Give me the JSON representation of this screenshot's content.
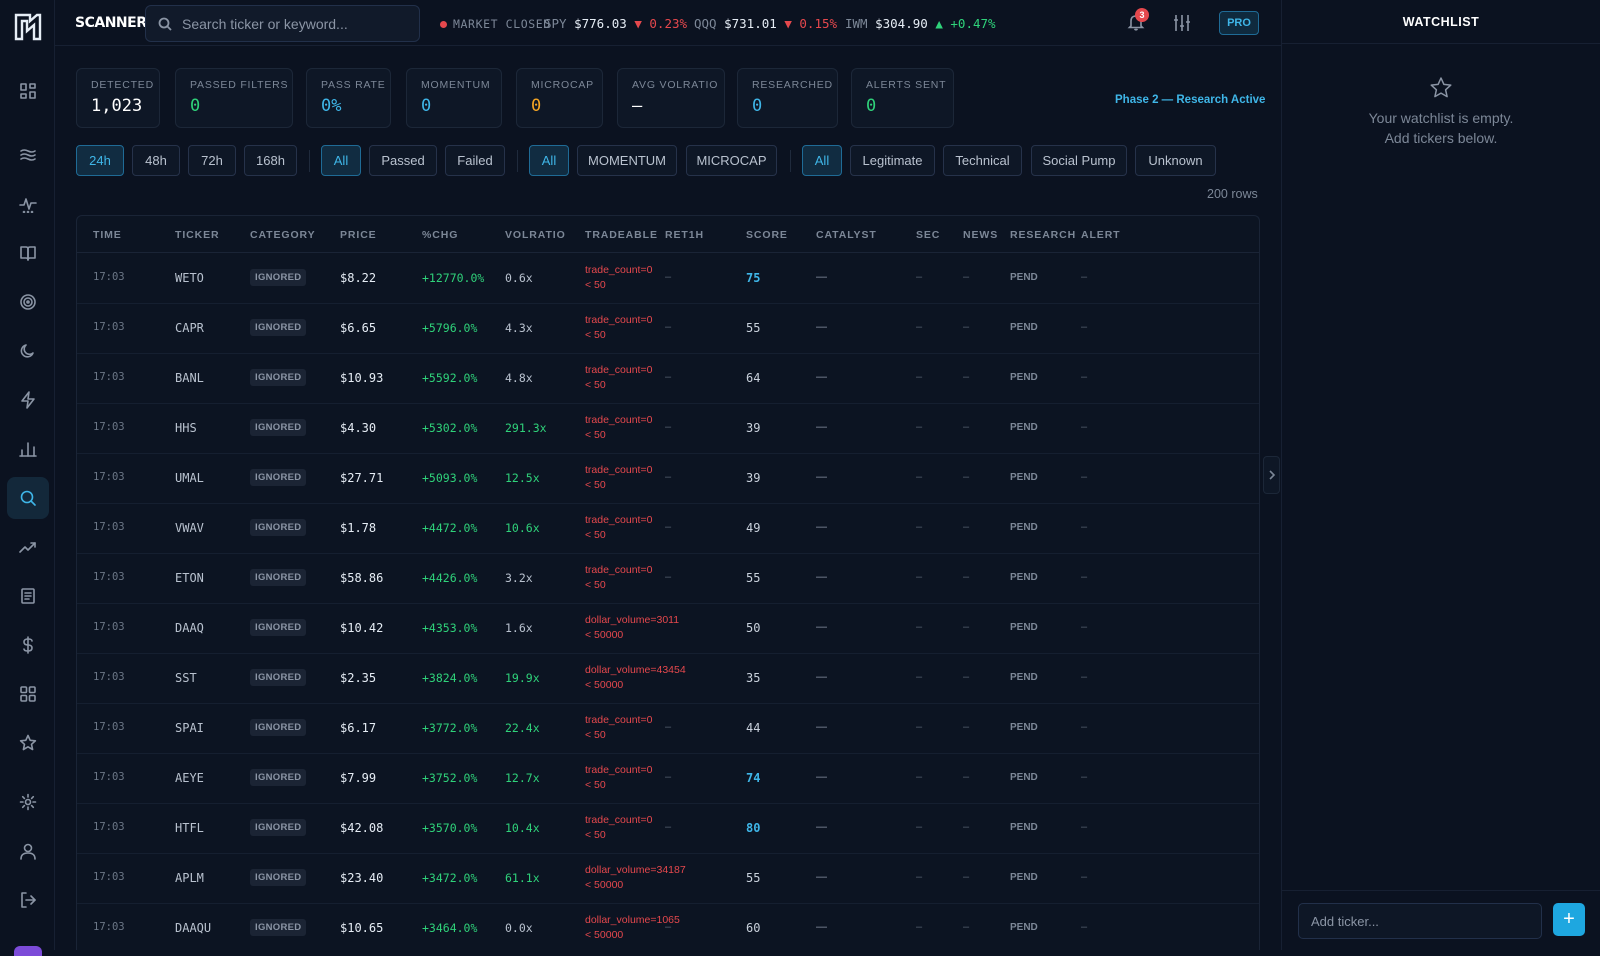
{
  "app": {
    "brand": "SCANNER",
    "search_placeholder": "Search ticker or keyword...",
    "market_status": "MARKET CLOSED",
    "indices": [
      {
        "sym": "SPY",
        "price": "$776.03",
        "arrow": "▼",
        "change": "0.23%",
        "dir": "down"
      },
      {
        "sym": "QQQ",
        "price": "$731.01",
        "arrow": "▼",
        "change": "0.15%",
        "dir": "down"
      },
      {
        "sym": "IWM",
        "price": "$304.90",
        "arrow": "▲",
        "change": "+0.47%",
        "dir": "up"
      }
    ],
    "notification_count": "3",
    "plan_badge": "PRO"
  },
  "stats": [
    {
      "label": "DETECTED",
      "value": "1,023",
      "color": "#ffffff"
    },
    {
      "label": "PASSED FILTERS",
      "value": "0",
      "color": "#2fd27a"
    },
    {
      "label": "PASS RATE",
      "value": "0%",
      "color": "#3fb6e8"
    },
    {
      "label": "MOMENTUM",
      "value": "0",
      "color": "#3fb6e8"
    },
    {
      "label": "MICROCAP",
      "value": "0",
      "color": "#f5a524"
    },
    {
      "label": "AVG VOLRATIO",
      "value": "—",
      "color": "#ffffff"
    },
    {
      "label": "RESEARCHED",
      "value": "0",
      "color": "#3fb6e8"
    },
    {
      "label": "ALERTS SENT",
      "value": "0",
      "color": "#2fd27a"
    }
  ],
  "phase_label": "Phase 2 — Research Active",
  "filters": {
    "timeframe": [
      "24h",
      "48h",
      "72h",
      "168h"
    ],
    "status": [
      "All",
      "Passed",
      "Failed"
    ],
    "category": [
      "All",
      "MOMENTUM",
      "MICROCAP"
    ],
    "research": [
      "All",
      "Legitimate",
      "Technical",
      "Social Pump",
      "Unknown"
    ]
  },
  "row_count": "200 rows",
  "table": {
    "columns": [
      "TIME",
      "TICKER",
      "CATEGORY",
      "PRICE",
      "%CHG",
      "VOLRATIO",
      "TRADEABLE",
      "RET1H",
      "SCORE",
      "CATALYST",
      "SEC",
      "NEWS",
      "RESEARCH",
      "ALERT"
    ],
    "rows": [
      {
        "time": "17:03",
        "ticker": "WETO",
        "category": "IGNORED",
        "price": "$8.22",
        "chg": "+12770.0%",
        "vol": "0.6x",
        "vol_hi": false,
        "trade1": "trade_count=0",
        "trade2": "< 50",
        "ret": "–",
        "score": "75",
        "score_hi": true,
        "catalyst": "—",
        "sec": "–",
        "news": "–",
        "research": "PEND",
        "alert": "–"
      },
      {
        "time": "17:03",
        "ticker": "CAPR",
        "category": "IGNORED",
        "price": "$6.65",
        "chg": "+5796.0%",
        "vol": "4.3x",
        "vol_hi": false,
        "trade1": "trade_count=0",
        "trade2": "< 50",
        "ret": "–",
        "score": "55",
        "score_hi": false,
        "catalyst": "—",
        "sec": "–",
        "news": "–",
        "research": "PEND",
        "alert": "–"
      },
      {
        "time": "17:03",
        "ticker": "BANL",
        "category": "IGNORED",
        "price": "$10.93",
        "chg": "+5592.0%",
        "vol": "4.8x",
        "vol_hi": false,
        "trade1": "trade_count=0",
        "trade2": "< 50",
        "ret": "–",
        "score": "64",
        "score_hi": false,
        "catalyst": "—",
        "sec": "–",
        "news": "–",
        "research": "PEND",
        "alert": "–"
      },
      {
        "time": "17:03",
        "ticker": "HHS",
        "category": "IGNORED",
        "price": "$4.30",
        "chg": "+5302.0%",
        "vol": "291.3x",
        "vol_hi": true,
        "trade1": "trade_count=0",
        "trade2": "< 50",
        "ret": "–",
        "score": "39",
        "score_hi": false,
        "catalyst": "—",
        "sec": "–",
        "news": "–",
        "research": "PEND",
        "alert": "–"
      },
      {
        "time": "17:03",
        "ticker": "UMAL",
        "category": "IGNORED",
        "price": "$27.71",
        "chg": "+5093.0%",
        "vol": "12.5x",
        "vol_hi": true,
        "trade1": "trade_count=0",
        "trade2": "< 50",
        "ret": "–",
        "score": "39",
        "score_hi": false,
        "catalyst": "—",
        "sec": "–",
        "news": "–",
        "research": "PEND",
        "alert": "–"
      },
      {
        "time": "17:03",
        "ticker": "VWAV",
        "category": "IGNORED",
        "price": "$1.78",
        "chg": "+4472.0%",
        "vol": "10.6x",
        "vol_hi": true,
        "trade1": "trade_count=0",
        "trade2": "< 50",
        "ret": "–",
        "score": "49",
        "score_hi": false,
        "catalyst": "—",
        "sec": "–",
        "news": "–",
        "research": "PEND",
        "alert": "–"
      },
      {
        "time": "17:03",
        "ticker": "ETON",
        "category": "IGNORED",
        "price": "$58.86",
        "chg": "+4426.0%",
        "vol": "3.2x",
        "vol_hi": false,
        "trade1": "trade_count=0",
        "trade2": "< 50",
        "ret": "–",
        "score": "55",
        "score_hi": false,
        "catalyst": "—",
        "sec": "–",
        "news": "–",
        "research": "PEND",
        "alert": "–"
      },
      {
        "time": "17:03",
        "ticker": "DAAQ",
        "category": "IGNORED",
        "price": "$10.42",
        "chg": "+4353.0%",
        "vol": "1.6x",
        "vol_hi": false,
        "trade1": "dollar_volume=3011",
        "trade2": "< 50000",
        "ret": "",
        "score": "50",
        "score_hi": false,
        "catalyst": "—",
        "sec": "–",
        "news": "–",
        "research": "PEND",
        "alert": "–"
      },
      {
        "time": "17:03",
        "ticker": "SST",
        "category": "IGNORED",
        "price": "$2.35",
        "chg": "+3824.0%",
        "vol": "19.9x",
        "vol_hi": true,
        "trade1": "dollar_volume=43454",
        "trade2": "< 50000",
        "ret": "",
        "score": "35",
        "score_hi": false,
        "catalyst": "—",
        "sec": "–",
        "news": "–",
        "research": "PEND",
        "alert": "–"
      },
      {
        "time": "17:03",
        "ticker": "SPAI",
        "category": "IGNORED",
        "price": "$6.17",
        "chg": "+3772.0%",
        "vol": "22.4x",
        "vol_hi": true,
        "trade1": "trade_count=0",
        "trade2": "< 50",
        "ret": "–",
        "score": "44",
        "score_hi": false,
        "catalyst": "—",
        "sec": "–",
        "news": "–",
        "research": "PEND",
        "alert": "–"
      },
      {
        "time": "17:03",
        "ticker": "AEYE",
        "category": "IGNORED",
        "price": "$7.99",
        "chg": "+3752.0%",
        "vol": "12.7x",
        "vol_hi": true,
        "trade1": "trade_count=0",
        "trade2": "< 50",
        "ret": "–",
        "score": "74",
        "score_hi": true,
        "catalyst": "—",
        "sec": "–",
        "news": "–",
        "research": "PEND",
        "alert": "–"
      },
      {
        "time": "17:03",
        "ticker": "HTFL",
        "category": "IGNORED",
        "price": "$42.08",
        "chg": "+3570.0%",
        "vol": "10.4x",
        "vol_hi": true,
        "trade1": "trade_count=0",
        "trade2": "< 50",
        "ret": "–",
        "score": "80",
        "score_hi": true,
        "catalyst": "—",
        "sec": "–",
        "news": "–",
        "research": "PEND",
        "alert": "–"
      },
      {
        "time": "17:03",
        "ticker": "APLM",
        "category": "IGNORED",
        "price": "$23.40",
        "chg": "+3472.0%",
        "vol": "61.1x",
        "vol_hi": true,
        "trade1": "dollar_volume=34187",
        "trade2": "< 50000",
        "ret": "",
        "score": "55",
        "score_hi": false,
        "catalyst": "—",
        "sec": "–",
        "news": "–",
        "research": "PEND",
        "alert": "–"
      },
      {
        "time": "17:03",
        "ticker": "DAAQU",
        "category": "IGNORED",
        "price": "$10.65",
        "chg": "+3464.0%",
        "vol": "0.0x",
        "vol_hi": false,
        "trade1": "dollar_volume=1065",
        "trade2": "< 50000",
        "ret": "–",
        "score": "60",
        "score_hi": false,
        "catalyst": "—",
        "sec": "–",
        "news": "–",
        "research": "PEND",
        "alert": "–"
      }
    ]
  },
  "watchlist": {
    "title": "WATCHLIST",
    "empty_line1": "Your watchlist is empty.",
    "empty_line2": "Add tickers below.",
    "input_placeholder": "Add ticker...",
    "add_label": "+"
  }
}
